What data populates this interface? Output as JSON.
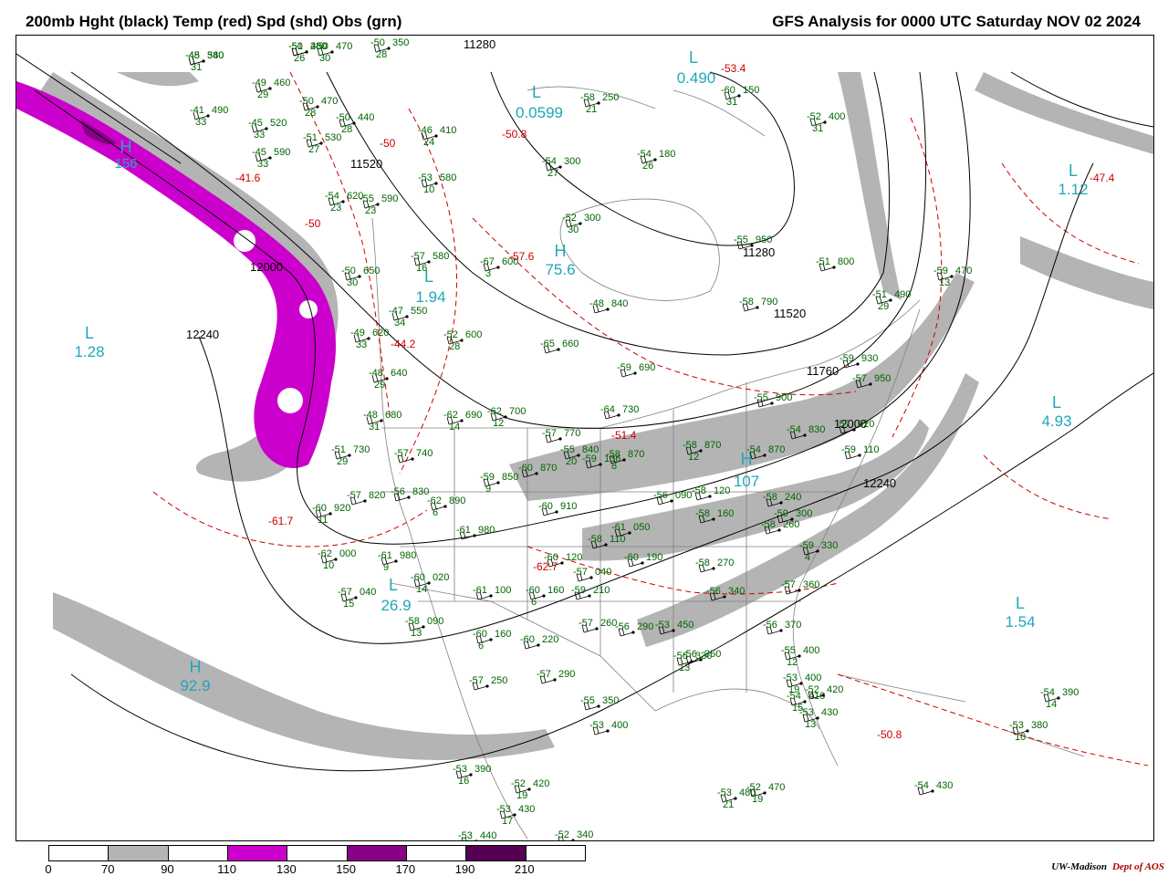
{
  "header": {
    "title_left": "200mb Hght (black) Temp (red) Spd (shd) Obs (grn)",
    "title_right": "GFS Analysis for 0000 UTC Saturday  NOV 02 2024"
  },
  "colors": {
    "height_contour": "#000000",
    "temperature_contour": "#cc0000",
    "observation_text": "#006400",
    "pressure_center_low": "#1fa8b8",
    "speed_70_90": "#b4b4b4",
    "speed_110_130": "#cc00cc",
    "speed_130_150": "#aa00aa",
    "speed_150_170": "#880088",
    "speed_190_210": "#550055",
    "borders": "#808080"
  },
  "height_labels": [
    {
      "text": "11280",
      "pos": "top"
    },
    {
      "text": "11520",
      "pos": "nw"
    },
    {
      "text": "12000",
      "pos": "west-center"
    },
    {
      "text": "12240",
      "pos": "west"
    },
    {
      "text": "11760",
      "pos": "east-center"
    },
    {
      "text": "12000",
      "pos": "east"
    },
    {
      "text": "12240",
      "pos": "southeast"
    },
    {
      "text": "11280",
      "pos": "canada-east"
    },
    {
      "text": "11520",
      "pos": "great-lakes-north"
    }
  ],
  "centers": [
    {
      "type": "L",
      "value": "1.28"
    },
    {
      "type": "L",
      "value": "0.490"
    },
    {
      "type": "L",
      "value": "0.0599"
    },
    {
      "type": "L",
      "value": "1.12"
    },
    {
      "type": "L",
      "value": "4.93"
    },
    {
      "type": "L",
      "value": "1.54"
    },
    {
      "type": "L",
      "value": "1.94"
    },
    {
      "type": "L",
      "value": "26.9"
    },
    {
      "type": "H",
      "value": "92.9"
    },
    {
      "type": "H",
      "value": "156"
    },
    {
      "type": "H",
      "value": "75.6"
    },
    {
      "type": "H",
      "value": "107"
    }
  ],
  "temperature_labels": [
    "-53.4",
    "-50.8",
    "-47.4",
    "-41.6",
    "-44.2",
    "-51.4",
    "-62.7",
    "-61.7",
    "-50.8",
    "-57.6",
    "-50",
    "-50"
  ],
  "observations": [
    {
      "t": "-48",
      "h": "380",
      "d": "31"
    },
    {
      "t": "-51",
      "h": "480",
      "d": "26"
    },
    {
      "t": "-50",
      "h": "470",
      "d": "30"
    },
    {
      "t": "-50",
      "h": "350",
      "d": "28"
    },
    {
      "t": "-49",
      "h": "460",
      "d": "29"
    },
    {
      "t": "-50",
      "h": "470",
      "d": "28"
    },
    {
      "t": "-41",
      "h": "490",
      "d": "33"
    },
    {
      "t": "-45",
      "h": "520",
      "d": "33"
    },
    {
      "t": "-50",
      "h": "440",
      "d": "28"
    },
    {
      "t": "-51",
      "h": "530",
      "d": "27"
    },
    {
      "t": "-45",
      "h": "590",
      "d": "33"
    },
    {
      "t": "-46",
      "h": "410",
      "d": "24"
    },
    {
      "t": "-58",
      "h": "250",
      "d": "21"
    },
    {
      "t": "-60",
      "h": "150",
      "d": "31"
    },
    {
      "t": "-52",
      "h": "400",
      "d": "31"
    },
    {
      "t": "-54",
      "h": "300",
      "d": "27"
    },
    {
      "t": "-54",
      "h": "180",
      "d": "26"
    },
    {
      "t": "-53",
      "h": "580",
      "d": "10"
    },
    {
      "t": "-54",
      "h": "620",
      "d": "23"
    },
    {
      "t": "-55",
      "h": "590",
      "d": "23"
    },
    {
      "t": "-52",
      "h": "300",
      "d": "30"
    },
    {
      "t": "-57",
      "h": "580",
      "d": "16"
    },
    {
      "t": "-67",
      "h": "600",
      "d": "3"
    },
    {
      "t": "-50",
      "h": "650",
      "d": "30"
    },
    {
      "t": "-47",
      "h": "550",
      "d": "34"
    },
    {
      "t": "-52",
      "h": "600",
      "d": "28"
    },
    {
      "t": "-49",
      "h": "620",
      "d": "33"
    },
    {
      "t": "-65",
      "h": "660",
      "d": ""
    },
    {
      "t": "-48",
      "h": "640",
      "d": "29"
    },
    {
      "t": "-59",
      "h": "690",
      "d": ""
    },
    {
      "t": "-48",
      "h": "680",
      "d": "31"
    },
    {
      "t": "-62",
      "h": "690",
      "d": "14"
    },
    {
      "t": "-62",
      "h": "700",
      "d": "12"
    },
    {
      "t": "-64",
      "h": "730",
      "d": ""
    },
    {
      "t": "-51",
      "h": "730",
      "d": "29"
    },
    {
      "t": "-57",
      "h": "740",
      "d": ""
    },
    {
      "t": "-57",
      "h": "770",
      "d": ""
    },
    {
      "t": "-55",
      "h": "840",
      "d": "20"
    },
    {
      "t": "-58",
      "h": "870",
      "d": "8"
    },
    {
      "t": "-59",
      "h": "850",
      "d": "9"
    },
    {
      "t": "-60",
      "h": "870",
      "d": ""
    },
    {
      "t": "-57",
      "h": "820",
      "d": ""
    },
    {
      "t": "-56",
      "h": "830",
      "d": ""
    },
    {
      "t": "-62",
      "h": "890",
      "d": "6"
    },
    {
      "t": "-60",
      "h": "920",
      "d": "11"
    },
    {
      "t": "-60",
      "h": "910",
      "d": ""
    },
    {
      "t": "-61",
      "h": "980",
      "d": ""
    },
    {
      "t": "-62",
      "h": "000",
      "d": "10"
    },
    {
      "t": "-61",
      "h": "980",
      "d": "9"
    },
    {
      "t": "-60",
      "h": "020",
      "d": "14"
    },
    {
      "t": "-57",
      "h": "040",
      "d": "15"
    },
    {
      "t": "-61",
      "h": "100",
      "d": ""
    },
    {
      "t": "-60",
      "h": "160",
      "d": "6"
    },
    {
      "t": "-60",
      "h": "120",
      "d": ""
    },
    {
      "t": "-60",
      "h": "190",
      "d": ""
    },
    {
      "t": "-59",
      "h": "210",
      "d": ""
    },
    {
      "t": "-58",
      "h": "090",
      "d": "13"
    },
    {
      "t": "-60",
      "h": "160",
      "d": "6"
    },
    {
      "t": "-60",
      "h": "220",
      "d": ""
    },
    {
      "t": "-57",
      "h": "260",
      "d": ""
    },
    {
      "t": "-56",
      "h": "290",
      "d": ""
    },
    {
      "t": "-57",
      "h": "250",
      "d": ""
    },
    {
      "t": "-57",
      "h": "290",
      "d": ""
    },
    {
      "t": "-55",
      "h": "350",
      "d": ""
    },
    {
      "t": "-53",
      "h": "400",
      "d": ""
    },
    {
      "t": "-53",
      "h": "390",
      "d": "16"
    },
    {
      "t": "-52",
      "h": "420",
      "d": "19"
    },
    {
      "t": "-53",
      "h": "430",
      "d": "17"
    },
    {
      "t": "-53",
      "h": "440",
      "d": ""
    },
    {
      "t": "-52",
      "h": "340",
      "d": ""
    },
    {
      "t": "-53",
      "h": "450",
      "d": ""
    },
    {
      "t": "-56",
      "h": "330",
      "d": "13"
    },
    {
      "t": "-56",
      "h": "350",
      "d": ""
    },
    {
      "t": "-56",
      "h": "370",
      "d": ""
    },
    {
      "t": "-55",
      "h": "400",
      "d": "12"
    },
    {
      "t": "-53",
      "h": "400",
      "d": "19"
    },
    {
      "t": "-54",
      "h": "410",
      "d": "15"
    },
    {
      "t": "-52",
      "h": "420",
      "d": ""
    },
    {
      "t": "-53",
      "h": "430",
      "d": "13"
    },
    {
      "t": "-53",
      "h": "480",
      "d": "21"
    },
    {
      "t": "-52",
      "h": "470",
      "d": "19"
    },
    {
      "t": "-54",
      "h": "430",
      "d": ""
    },
    {
      "t": "-53",
      "h": "380",
      "d": "10"
    },
    {
      "t": "-54",
      "h": "390",
      "d": "14"
    },
    {
      "t": "-58",
      "h": "260",
      "d": ""
    },
    {
      "t": "-56",
      "h": "340",
      "d": ""
    },
    {
      "t": "-57",
      "h": "360",
      "d": ""
    },
    {
      "t": "-59",
      "h": "330",
      "d": "4"
    },
    {
      "t": "-58",
      "h": "270",
      "d": ""
    },
    {
      "t": "-59",
      "h": "300",
      "d": ""
    },
    {
      "t": "-58",
      "h": "240",
      "d": ""
    },
    {
      "t": "-58",
      "h": "160",
      "d": ""
    },
    {
      "t": "-58",
      "h": "120",
      "d": ""
    },
    {
      "t": "-56",
      "h": "090",
      "d": ""
    },
    {
      "t": "-61",
      "h": "050",
      "d": ""
    },
    {
      "t": "-58",
      "h": "110",
      "d": ""
    },
    {
      "t": "-57",
      "h": "040",
      "d": ""
    },
    {
      "t": "-59",
      "h": "136",
      "d": ""
    },
    {
      "t": "-58",
      "h": "870",
      "d": "12"
    },
    {
      "t": "-54",
      "h": "870",
      "d": ""
    },
    {
      "t": "-55",
      "h": "900",
      "d": ""
    },
    {
      "t": "-54",
      "h": "830",
      "d": ""
    },
    {
      "t": "-57",
      "h": "020",
      "d": ""
    },
    {
      "t": "-59",
      "h": "110",
      "d": ""
    },
    {
      "t": "-57",
      "h": "950",
      "d": ""
    },
    {
      "t": "-59",
      "h": "930",
      "d": ""
    },
    {
      "t": "-58",
      "h": "790",
      "d": ""
    },
    {
      "t": "-48",
      "h": "840",
      "d": ""
    },
    {
      "t": "-51",
      "h": "490",
      "d": "29"
    },
    {
      "t": "-59",
      "h": "470",
      "d": "13"
    },
    {
      "t": "-51",
      "h": "800",
      "d": ""
    },
    {
      "t": "-55",
      "h": "950",
      "d": ""
    },
    {
      "t": "-45",
      "h": "540",
      "d": ""
    },
    {
      "t": "-50",
      "h": "280",
      "d": ""
    }
  ],
  "colorbar": {
    "ticks": [
      "0",
      "70",
      "90",
      "110",
      "130",
      "150",
      "170",
      "190",
      "210"
    ],
    "fills": [
      "#ffffff",
      "#b4b4b4",
      "#ffffff",
      "#cc00cc",
      "#ffffff",
      "#880088",
      "#ffffff",
      "#550055",
      "#ffffff"
    ]
  },
  "credit": {
    "org": "UW-Madison",
    "dept": "Dept of AOS"
  }
}
